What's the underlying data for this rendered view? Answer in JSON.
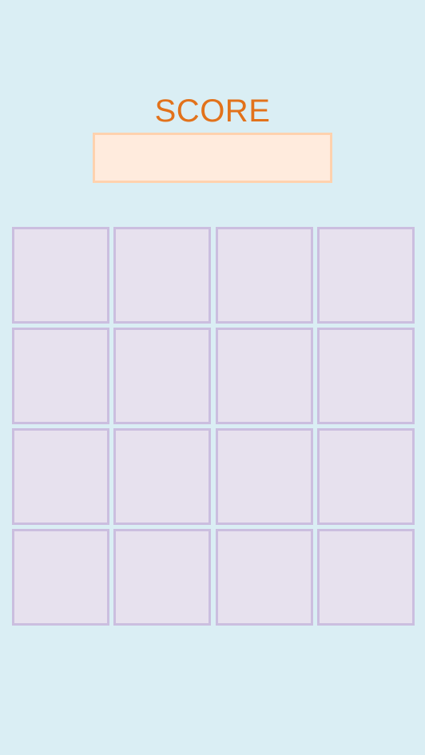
{
  "header": {
    "score_label": "SCORE",
    "score_value": ""
  },
  "board": {
    "rows": [
      [
        "",
        "",
        "",
        ""
      ],
      [
        "",
        "",
        "",
        ""
      ],
      [
        "",
        "",
        "",
        ""
      ],
      [
        "",
        "",
        "",
        ""
      ]
    ]
  },
  "colors": {
    "background": "#daeef4",
    "score_text": "#e2721b",
    "score_box_fill": "#ffebdd",
    "score_box_border": "#ffd2ae",
    "tile_fill": "#e7e1ee",
    "tile_border": "#cbbedf"
  }
}
